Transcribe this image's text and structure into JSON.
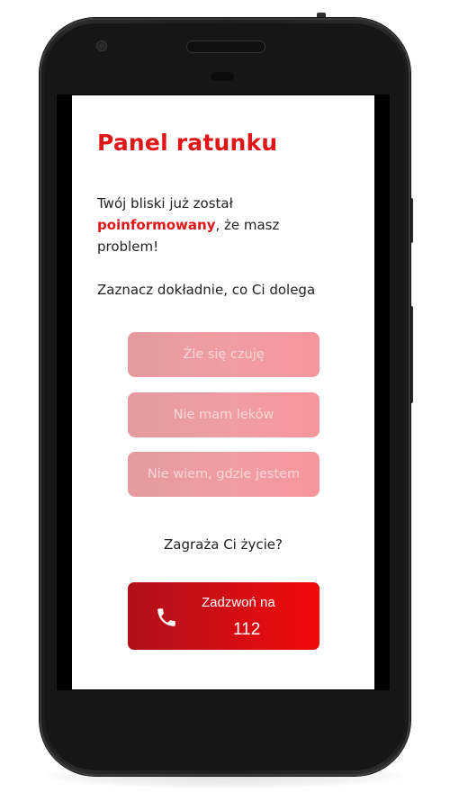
{
  "screen": {
    "title": "Panel ratunku",
    "message": {
      "part1": "Twój bliski już został",
      "highlight": "poinformowany",
      "part2": ", że masz problem!"
    },
    "instruction": "Zaznacz dokładnie, co Ci dolega",
    "options": [
      {
        "label": "Źle się czuję"
      },
      {
        "label": "Nie mam leków"
      },
      {
        "label": "Nie wiem, gdzie jestem"
      }
    ],
    "question": "Zagraża Ci życie?",
    "call_button": {
      "line1": "Zadzwoń na",
      "line2": "112",
      "icon": "phone-icon"
    }
  },
  "colors": {
    "accent": "#e01515",
    "option_bg": "#f09da3",
    "call_gradient_start": "#b0101a",
    "call_gradient_end": "#f30a0a",
    "phone_body": "#1e1e1e"
  }
}
